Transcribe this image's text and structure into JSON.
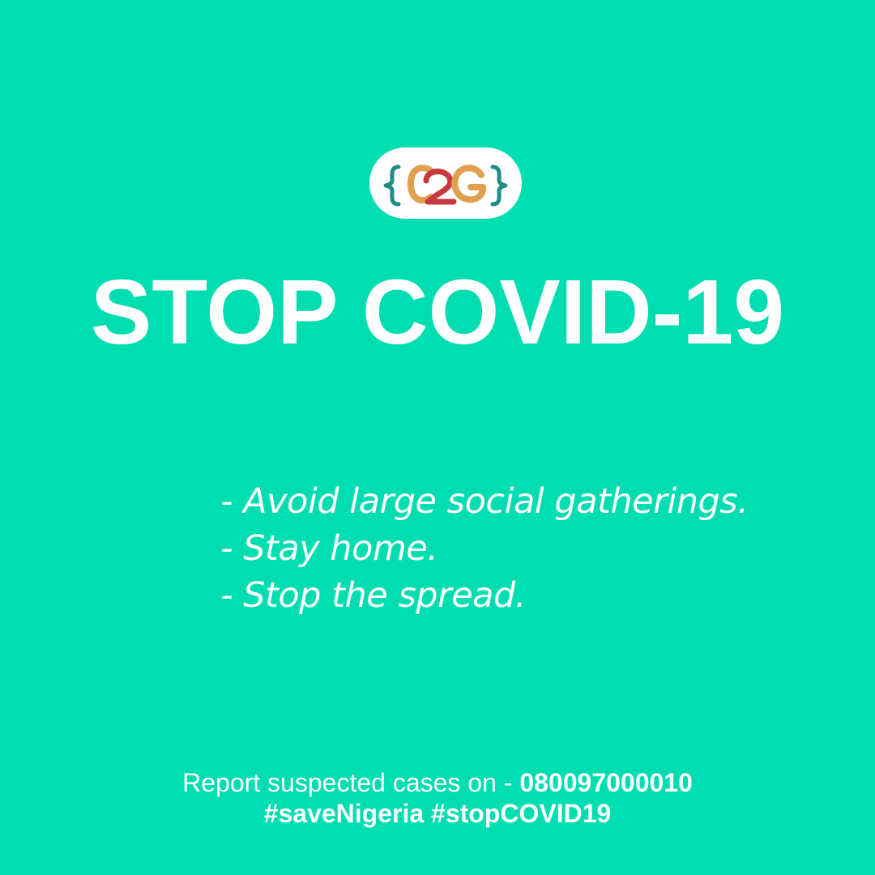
{
  "colors": {
    "background": "#00ddb0",
    "text": "#ffffff",
    "logo_teal": "#1f8d85",
    "logo_orange": "#e0a04f",
    "logo_red": "#c8373b"
  },
  "logo": {
    "icon": "c2g-logo",
    "text": "{C2G}"
  },
  "headline": "STOP COVID-19",
  "tips": [
    "- Avoid large social gatherings.",
    "- Stay home.",
    "- Stop the spread."
  ],
  "footer": {
    "report_text": "Report suspected cases on - ",
    "phone": "080097000010",
    "hashtags": "#saveNigeria #stopCOVID19"
  }
}
